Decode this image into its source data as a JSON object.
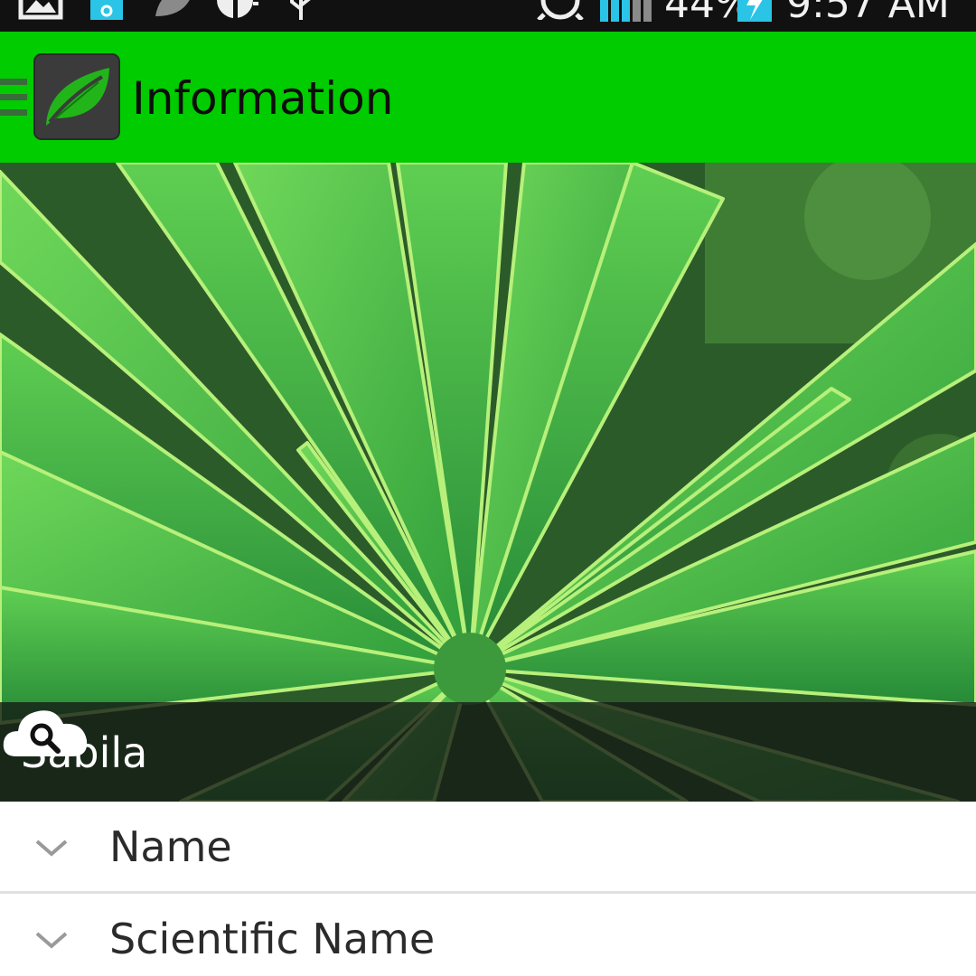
{
  "status_bar": {
    "battery": "44%",
    "time": "9:57 AM",
    "icons": [
      "gallery-icon",
      "usb-debug-icon",
      "leaf-notification-icon",
      "alarm-vibrate-icon",
      "usb-icon",
      "alarm-clock-icon",
      "signal-icon",
      "battery-charging-icon"
    ]
  },
  "app_bar": {
    "title": "Information",
    "menu_icon": "hamburger-icon",
    "logo_icon": "leaf-icon",
    "color": "#00cc00"
  },
  "hero": {
    "caption": "Sabila",
    "action_icon": "cloud-search-icon"
  },
  "sections": [
    {
      "label": "Name",
      "icon": "chevron-down-icon"
    },
    {
      "label": "Scientific Name",
      "icon": "chevron-down-icon"
    }
  ]
}
